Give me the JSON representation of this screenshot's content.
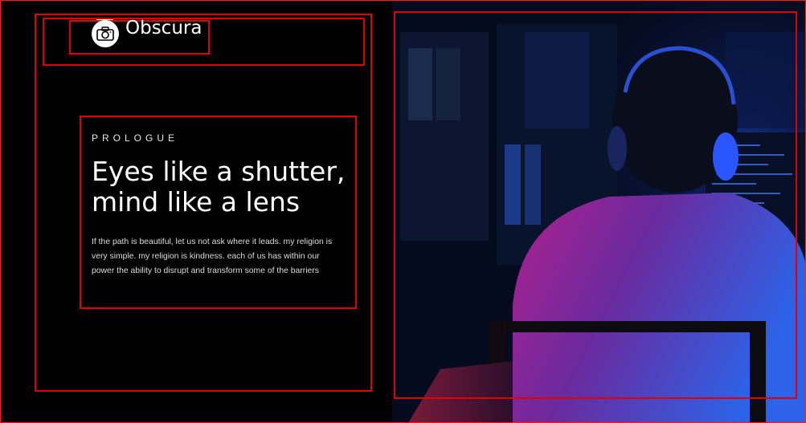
{
  "brand": {
    "name": "Obscura",
    "logo_icon": "camera-icon"
  },
  "hero": {
    "eyebrow": "PROLOGUE",
    "headline_line1": "Eyes like a shutter,",
    "headline_line2": "mind like a lens",
    "body": "If the path is beautiful, let us not ask where it leads. my religion is very simple. my religion is kindness. each of us has within our power the ability to disrupt and transform some of the barriers"
  },
  "photo": {
    "subject": "person-with-headphones-at-computer"
  },
  "colors": {
    "background": "#000000",
    "highlight_border": "#e00000",
    "text": "#ffffff",
    "photo_blue": "#1a3cff",
    "photo_magenta": "#c0208a"
  }
}
